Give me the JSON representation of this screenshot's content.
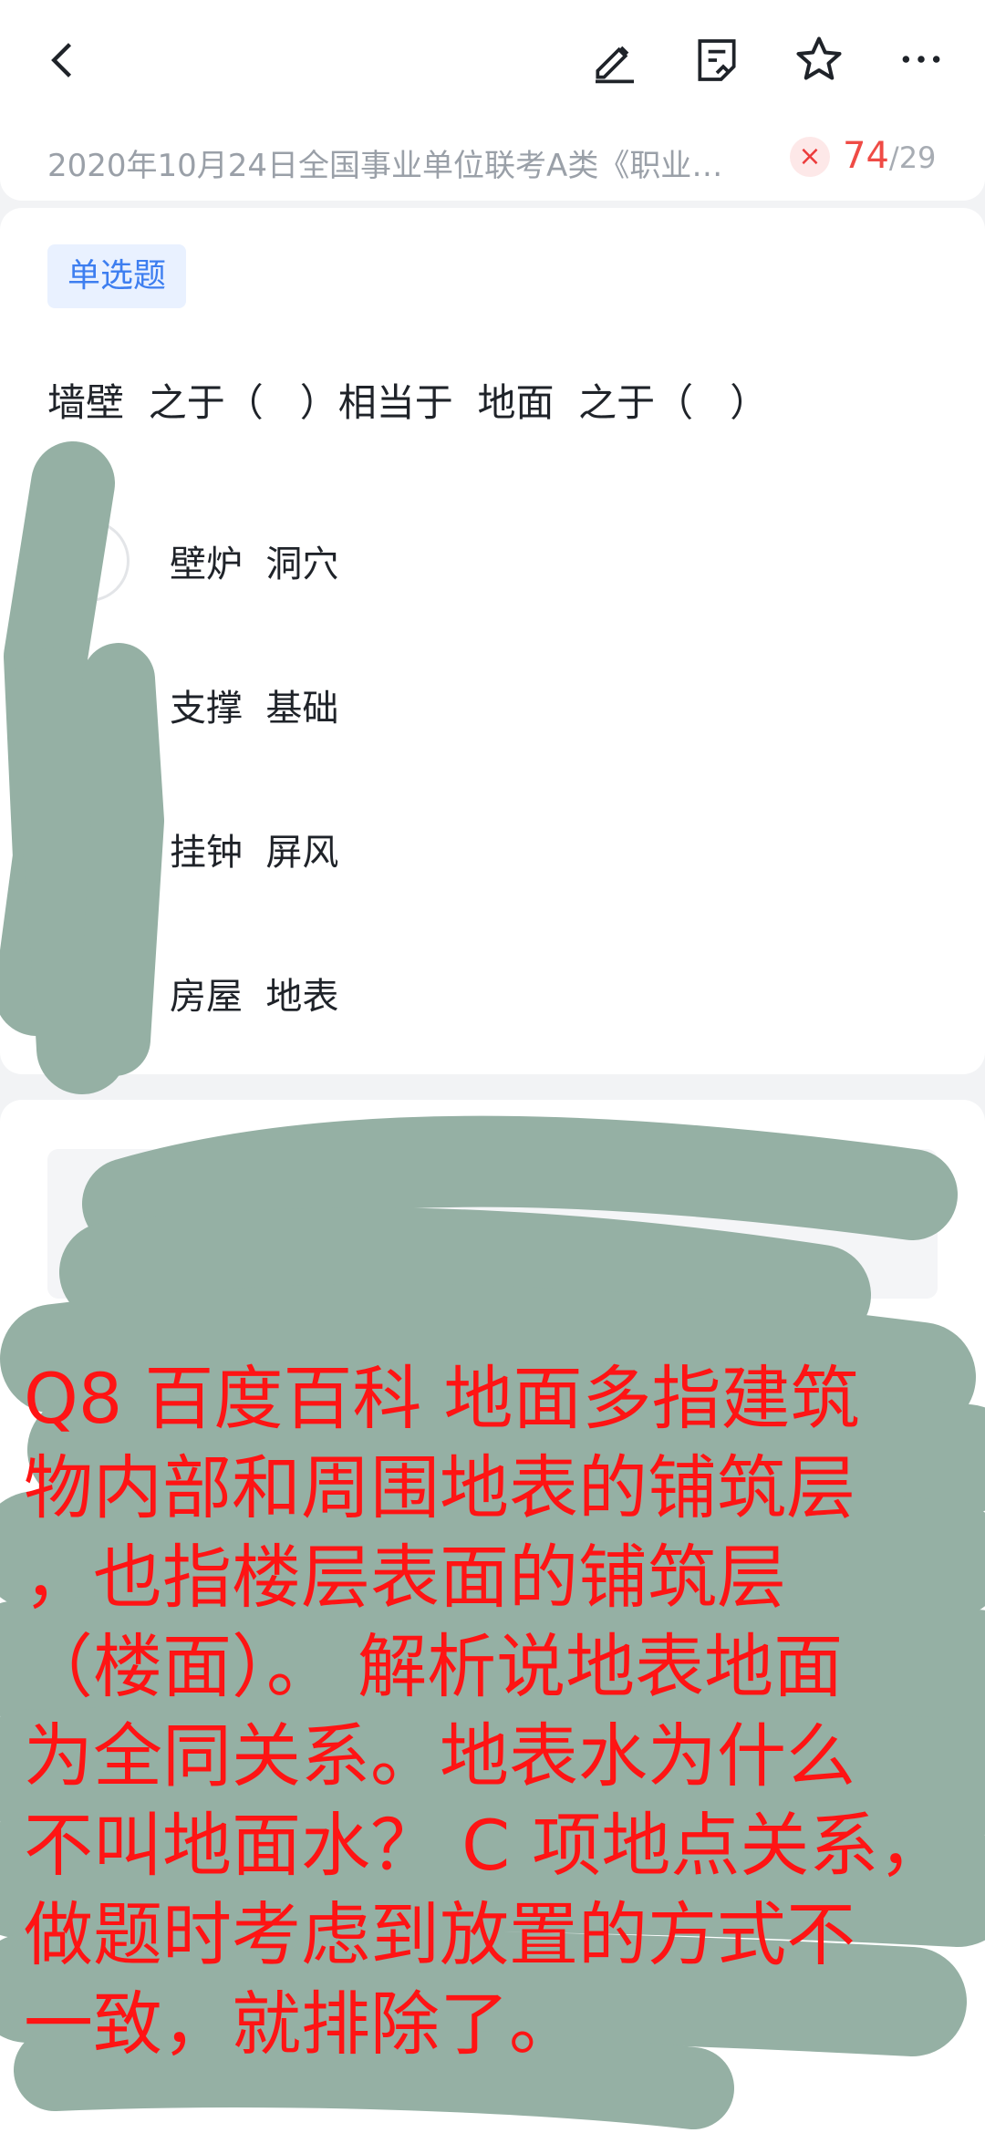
{
  "header": {
    "back_icon": "chevron-left-icon",
    "edit_icon": "pencil-icon",
    "notes_icon": "notes-icon",
    "favorite_icon": "star-icon",
    "more_icon": "more-horizontal-icon"
  },
  "exam": {
    "title": "2020年10月24日全国事业单位联考A类《职业能...",
    "wrong_mark": "×",
    "current": "74",
    "total": "/29"
  },
  "question": {
    "type_label": "单选题",
    "stem": "墙壁  之于（   ）相当于  地面  之于（   ）",
    "options": [
      {
        "text": "壁炉  洞穴"
      },
      {
        "text": "支撑  基础"
      },
      {
        "text": "挂钟  屏风"
      },
      {
        "text": "房屋  地表"
      }
    ]
  },
  "annotation": {
    "color": "#ff1414",
    "lines": [
      "Q8 百度百科 地面多指建筑",
      "物内部和周围地表的铺筑层",
      "，也指楼层表面的铺筑层",
      "（楼面）。 解析说地表地面",
      "为全同关系。地表水为什么",
      "不叫地面水？ C 项地点关系，",
      "做题时考虑到放置的方式不",
      "一致，就排除了。"
    ]
  },
  "colors": {
    "scribble": "#95b0a4",
    "accent_blue": "#3d7ef0",
    "wrong_red": "#ef4b45"
  }
}
